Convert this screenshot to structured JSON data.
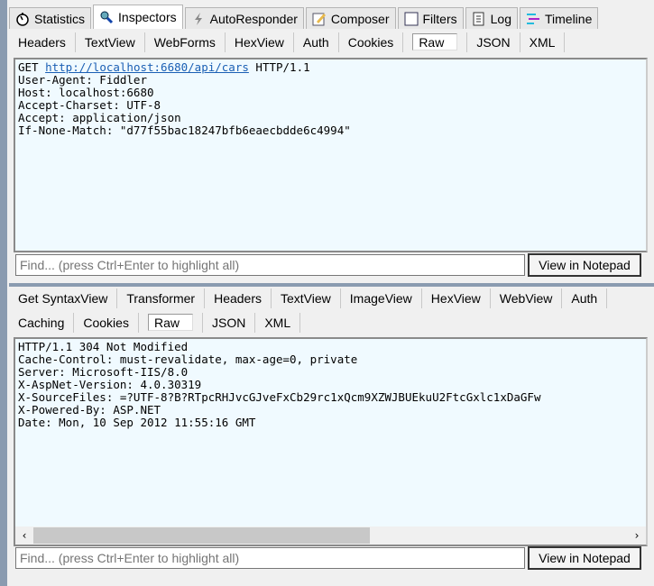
{
  "main_tabs": [
    {
      "label": "Statistics",
      "icon": "stopwatch-icon"
    },
    {
      "label": "Inspectors",
      "icon": "inspectors-icon",
      "active": true
    },
    {
      "label": "AutoResponder",
      "icon": "lightning-icon"
    },
    {
      "label": "Composer",
      "icon": "composer-icon"
    },
    {
      "label": "Filters",
      "icon": "checkbox-icon"
    },
    {
      "label": "Log",
      "icon": "log-icon"
    },
    {
      "label": "Timeline",
      "icon": "timeline-icon"
    }
  ],
  "request": {
    "tabs": [
      "Headers",
      "TextView",
      "WebForms",
      "HexView",
      "Auth",
      "Cookies",
      "Raw",
      "JSON",
      "XML"
    ],
    "active_tab": "Raw",
    "method": "GET",
    "url": "http://localhost:6680/api/cars",
    "protocol": "HTTP/1.1",
    "lines": [
      "User-Agent: Fiddler",
      "Host: localhost:6680",
      "Accept-Charset: UTF-8",
      "Accept: application/json",
      "If-None-Match: \"d77f55bac18247bfb6eaecbdde6c4994\""
    ],
    "find_placeholder": "Find... (press Ctrl+Enter to highlight all)",
    "notepad_button": "View in Notepad"
  },
  "response": {
    "tabs_row1": [
      "Get SyntaxView",
      "Transformer",
      "Headers",
      "TextView",
      "ImageView",
      "HexView",
      "WebView",
      "Auth"
    ],
    "tabs_row2": [
      "Caching",
      "Cookies",
      "Raw",
      "JSON",
      "XML"
    ],
    "active_tab": "Raw",
    "lines": [
      "HTTP/1.1 304 Not Modified",
      "Cache-Control: must-revalidate, max-age=0, private",
      "Server: Microsoft-IIS/8.0",
      "X-AspNet-Version: 4.0.30319",
      "X-SourceFiles: =?UTF-8?B?RTpcRHJvcGJveFxCb29rc1xQcm9XZWJBUEkuU2FtcGxlc1xDaGFw",
      "X-Powered-By: ASP.NET",
      "Date: Mon, 10 Sep 2012 11:55:16 GMT"
    ],
    "find_placeholder": "Find... (press Ctrl+Enter to highlight all)",
    "notepad_button": "View in Notepad",
    "hscroll_position": 0
  }
}
